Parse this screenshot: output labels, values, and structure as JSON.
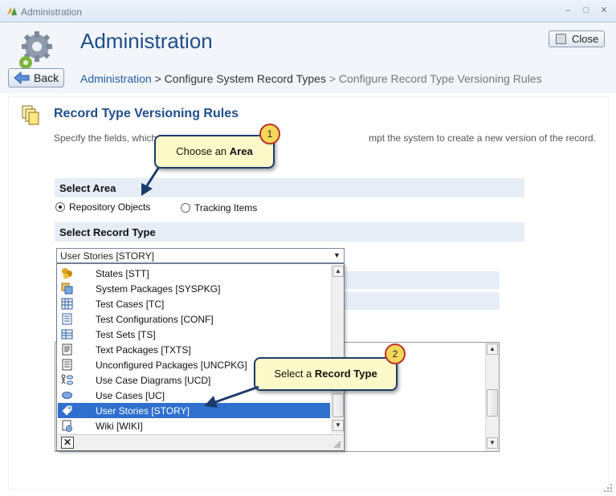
{
  "window": {
    "title": "Administration",
    "controls": [
      "minimize",
      "maximize",
      "close"
    ]
  },
  "header": {
    "title": "Administration",
    "close_label": "Close",
    "back_label": "Back",
    "breadcrumb": {
      "root": "Administration",
      "sep": ">",
      "middle": "Configure System Record Types",
      "current": "Configure Record Type Versioning Rules"
    }
  },
  "section": {
    "title": "Record Type Versioning Rules",
    "description_start": "Specify the fields, which",
    "description_end": "mpt the system to create a new version of the record."
  },
  "select_area": {
    "heading": "Select Area",
    "options": [
      {
        "label": "Repository Objects",
        "checked": true
      },
      {
        "label": "Tracking Items",
        "checked": false
      }
    ]
  },
  "select_record_type": {
    "heading": "Select Record Type",
    "value": "User Stories [STORY]",
    "options": [
      {
        "label": "States [STT]",
        "icon": "states-icon"
      },
      {
        "label": "System Packages [SYSPKG]",
        "icon": "system-packages-icon"
      },
      {
        "label": "Test Cases [TC]",
        "icon": "test-cases-icon"
      },
      {
        "label": "Test Configurations [CONF]",
        "icon": "test-configurations-icon"
      },
      {
        "label": "Test Sets [TS]",
        "icon": "test-sets-icon"
      },
      {
        "label": "Text Packages [TXTS]",
        "icon": "text-packages-icon"
      },
      {
        "label": "Unconfigured Packages [UNCPKG]",
        "icon": "unconfigured-packages-icon"
      },
      {
        "label": "Use Case Diagrams [UCD]",
        "icon": "use-case-diagrams-icon"
      },
      {
        "label": "Use Cases [UC]",
        "icon": "use-cases-icon"
      },
      {
        "label": "User Stories [STORY]",
        "icon": "user-stories-icon",
        "selected": true
      },
      {
        "label": "Wiki [WIKI]",
        "icon": "wiki-icon"
      }
    ]
  },
  "callouts": [
    {
      "number": "1",
      "text_prefix": "Choose an ",
      "text_bold": "Area"
    },
    {
      "number": "2",
      "text_prefix": "Select a ",
      "text_bold": "Record Type"
    }
  ],
  "colors": {
    "title_blue": "#1f4e8c",
    "band": "#e7edf6",
    "selection": "#2f6fce",
    "callout_fill": "#fef9c8",
    "callout_border": "#1c3b6b",
    "badge_fill": "#f7d75a",
    "badge_border": "#b8322a"
  }
}
